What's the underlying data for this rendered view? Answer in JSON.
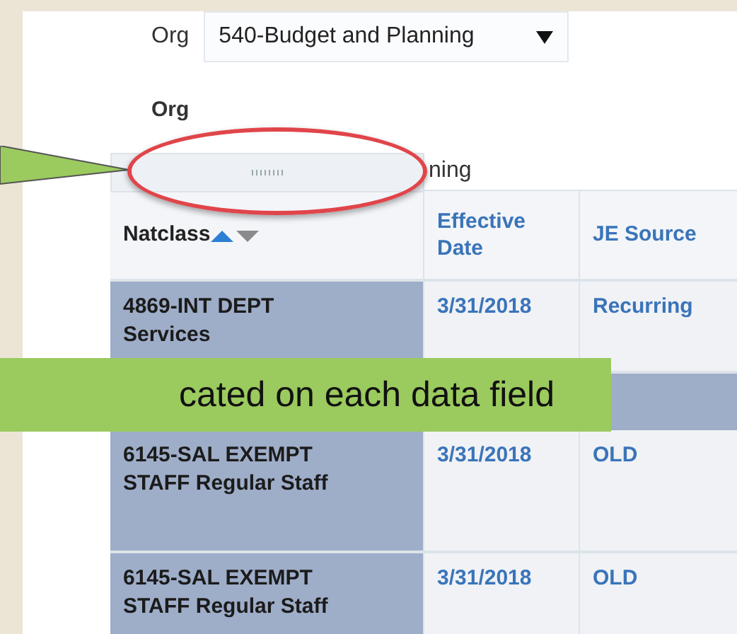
{
  "filter": {
    "label": "Org",
    "value": "540-Budget and Planning"
  },
  "group": {
    "label": "Org",
    "value": "ning"
  },
  "table": {
    "columns": [
      {
        "label": "Natclass",
        "sort_ascending": true
      },
      {
        "label": "Effective Date"
      },
      {
        "label": "JE Source"
      }
    ],
    "rows": [
      {
        "kind": "data",
        "cells": [
          "4869-INT DEPT Services",
          "3/31/2018",
          "Recurring"
        ]
      },
      {
        "kind": "band"
      },
      {
        "kind": "data",
        "cells": [
          "6145-SAL EXEMPT STAFF Regular Staff",
          "3/31/2018",
          "OLD"
        ]
      },
      {
        "kind": "data",
        "cells": [
          "6145-SAL EXEMPT STAFF Regular Staff",
          "3/31/2018",
          "OLD"
        ]
      }
    ]
  },
  "callout": {
    "text": "cated on each data field"
  }
}
